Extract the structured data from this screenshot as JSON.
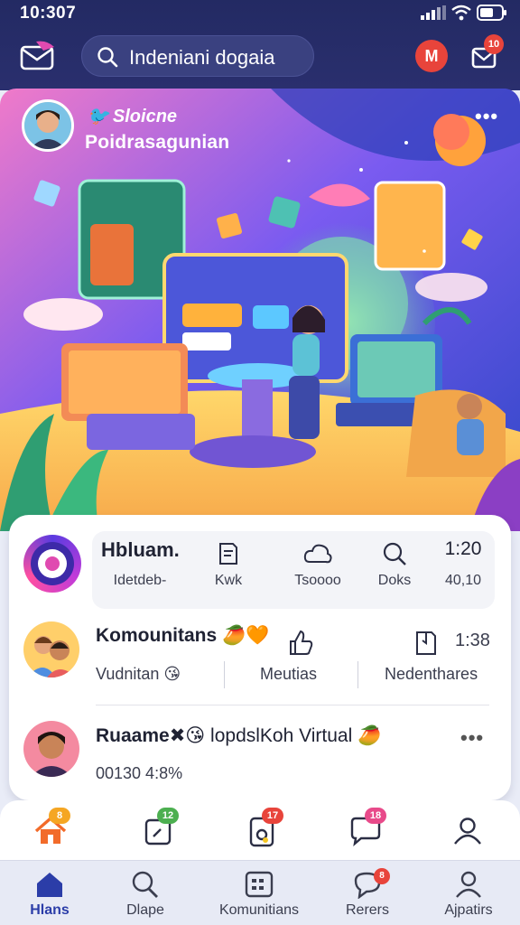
{
  "status_bar": {
    "time": "10:307"
  },
  "header": {
    "search_placeholder": "Indeniani dogaia",
    "profile_initial": "M",
    "notifications_count": "10"
  },
  "hero": {
    "handle": "Sloicne",
    "title": "Poidrasagunian",
    "more_label": "•••"
  },
  "stats_row": {
    "items": [
      {
        "top": "Hbluam.",
        "bottom": "Idetdeb-",
        "icon": ""
      },
      {
        "top": "",
        "bottom": "Kwk",
        "icon": "page-icon"
      },
      {
        "top": "",
        "bottom": "Tsoooo",
        "icon": "cloud-icon"
      },
      {
        "top": "",
        "bottom": "Doks",
        "icon": "search-icon"
      },
      {
        "top": "1:20",
        "bottom": "40,10",
        "icon": ""
      }
    ]
  },
  "posts": [
    {
      "name": "Komounitans",
      "emoji": "🥭🧡",
      "meta1": "Vudnitan",
      "meta1_emoji": "😘",
      "meta2": "Meutias",
      "meta3": "Nedenthares",
      "count": "1:38"
    },
    {
      "name": "Ruaame",
      "emoji": "✖😘",
      "name_suffix": "lopdslKoh Virtual",
      "suffix_emoji": "🥭",
      "meta1": "00130 4:8%",
      "more": "•••"
    }
  ],
  "action_bar": {
    "badges": [
      "8",
      "12",
      "17",
      "18"
    ],
    "badge_colors": [
      "#f5a623",
      "#4caf50",
      "#e8443b",
      "#e84a8a"
    ]
  },
  "bottom_nav": {
    "items": [
      {
        "label": "Hlans",
        "icon": "home-icon",
        "active": true
      },
      {
        "label": "Dlape",
        "icon": "search-icon",
        "active": false
      },
      {
        "label": "Komunitians",
        "icon": "grid-icon",
        "active": false
      },
      {
        "label": "Rerers",
        "icon": "chat-icon",
        "active": false,
        "badge": "8"
      },
      {
        "label": "Ajpatirs",
        "icon": "profile-icon",
        "active": false
      }
    ]
  },
  "colors": {
    "header_bg": "#232a63",
    "accent": "#2b3da8",
    "alert": "#e8443b"
  }
}
